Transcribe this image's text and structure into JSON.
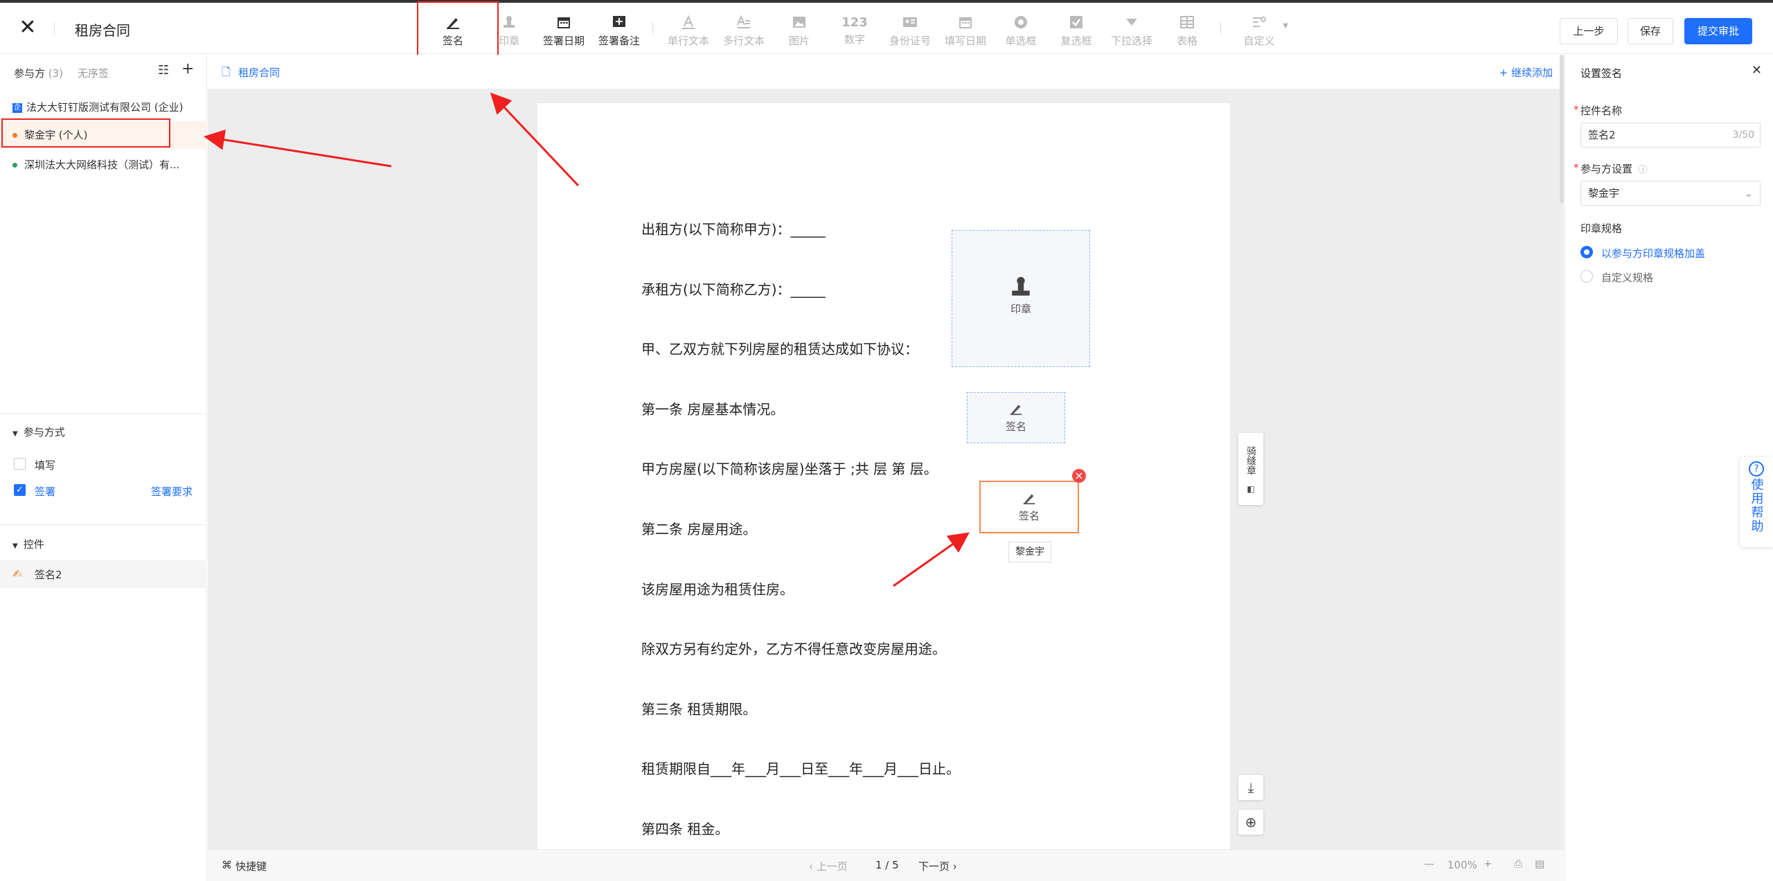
{
  "header": {
    "title": "租房合同",
    "prev_label": "上一步",
    "save_label": "保存",
    "submit_label": "提交审批"
  },
  "toolbar": [
    {
      "label": "签名",
      "icon": "signature-icon",
      "enabled": true
    },
    {
      "label": "印章",
      "icon": "stamp-icon",
      "enabled": false
    },
    {
      "label": "签署日期",
      "icon": "calendar-icon",
      "enabled": true
    },
    {
      "label": "签署备注",
      "icon": "note-plus-icon",
      "enabled": true
    },
    {
      "label": "单行文本",
      "icon": "text-single-icon",
      "enabled": false
    },
    {
      "label": "多行文本",
      "icon": "text-multi-icon",
      "enabled": false
    },
    {
      "label": "图片",
      "icon": "image-icon",
      "enabled": false
    },
    {
      "label": "数字",
      "icon": "number-icon",
      "glyph": "123",
      "enabled": false
    },
    {
      "label": "身份证号",
      "icon": "id-card-icon",
      "enabled": false
    },
    {
      "label": "填写日期",
      "icon": "calendar-icon",
      "enabled": false
    },
    {
      "label": "单选框",
      "icon": "radio-icon",
      "enabled": false
    },
    {
      "label": "复选框",
      "icon": "checkbox-icon",
      "enabled": false
    },
    {
      "label": "下拉选择",
      "icon": "dropdown-icon",
      "enabled": false
    },
    {
      "label": "表格",
      "icon": "table-icon",
      "enabled": false
    },
    {
      "label": "自定义",
      "icon": "custom-icon",
      "enabled": false
    }
  ],
  "left": {
    "tab_participants": "参与方",
    "participant_count": "(3)",
    "tab_unordered": "无序签",
    "participants": [
      {
        "name": "法大大钉钉版测试有限公司 (企业)",
        "type": "company"
      },
      {
        "name": "黎金宇 (个人)",
        "type": "person",
        "color": "#f07a2e",
        "selected": true
      },
      {
        "name": "深圳法大大网络科技（测试）有...",
        "type": "company2",
        "color": "#2a9d6e"
      }
    ],
    "method_title": "参与方式",
    "methods": [
      {
        "label": "填写",
        "checked": false
      },
      {
        "label": "签署",
        "checked": true,
        "link": "签署要求"
      }
    ],
    "controls_title": "控件",
    "controls": [
      {
        "label": "签名2"
      }
    ]
  },
  "canvas": {
    "doc_tab": "租房合同",
    "continue_add": "+ 继续添加",
    "lines": [
      "出租方(以下简称甲方)：_____",
      "承租方(以下简称乙方)：_____",
      "甲、乙双方就下列房屋的租赁达成如下协议：",
      "第一条  房屋基本情况。",
      "甲方房屋(以下简称该房屋)坐落于  ;共  层  第  层。",
      "第二条  房屋用途。",
      "该房屋用途为租赁住房。",
      "除双方另有约定外，乙方不得任意改变房屋用途。",
      "第三条  租赁期限。",
      "租赁期限自___年___月___日至___年___月___日止。",
      "第四条  租金。"
    ],
    "stamp_label": "印章",
    "sig1_label": "签名",
    "sig2_label": "签名",
    "sig2_owner": "黎金宇",
    "seal_tool": "骑缝章"
  },
  "bottom": {
    "shortcut": "快捷键",
    "prev_page": "上一页",
    "page": "1 / 5",
    "next_page": "下一页",
    "zoom": "100%"
  },
  "right": {
    "title": "设置签名",
    "name_label": "控件名称",
    "name_value": "签名2",
    "name_count": "3/50",
    "party_label": "参与方设置",
    "party_value": "黎金宇",
    "spec_label": "印章规格",
    "spec_options": [
      {
        "label": "以参与方印章规格加盖",
        "selected": true
      },
      {
        "label": "自定义规格",
        "selected": false
      }
    ]
  },
  "help": "使用帮助",
  "colors": {
    "primary": "#1f6fff",
    "annotation_red": "#f02020",
    "selected_orange": "#f88a55"
  }
}
